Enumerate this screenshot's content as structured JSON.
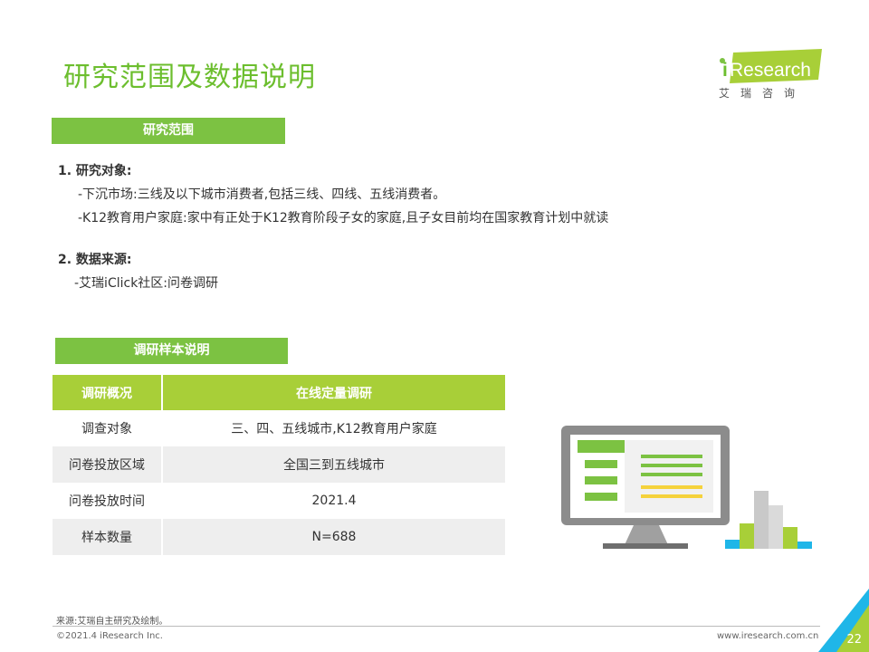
{
  "title": "研究范围及数据说明",
  "logo": {
    "brand": "iResearch",
    "cn": "艾瑞咨询"
  },
  "scope_section": {
    "label": "研究范围",
    "item1_heading": "1.  研究对象:",
    "item1_lines": [
      "-下沉市场:三线及以下城市消费者,包括三线、四线、五线消费者。",
      "-K12教育用户家庭:家中有正处于K12教育阶段子女的家庭,且子女目前均在国家教育计划中就读"
    ],
    "item2_heading": "2.  数据来源:",
    "item2_lines": [
      "-艾瑞iClick社区:问卷调研"
    ]
  },
  "sample_section": {
    "label": "调研样本说明",
    "table": {
      "headers": [
        "调研概况",
        "在线定量调研"
      ],
      "rows": [
        [
          "调查对象",
          "三、四、五线城市,K12教育用户家庭"
        ],
        [
          "问卷投放区域",
          "全国三到五线城市"
        ],
        [
          "问卷投放时间",
          "2021.4"
        ],
        [
          "样本数量",
          "N=688"
        ]
      ]
    }
  },
  "footer": {
    "source": "来源:艾瑞自主研究及绘制。",
    "copyright": "©2021.4 iResearch Inc.",
    "website": "www.iresearch.com.cn",
    "page_number": "22"
  },
  "colors": {
    "accent_green": "#7CC242",
    "table_header": "#A8CF38",
    "monitor_gray": "#8C8C8C",
    "chart_blue": "#1FB6E8",
    "chart_yellow": "#F5D23C"
  }
}
